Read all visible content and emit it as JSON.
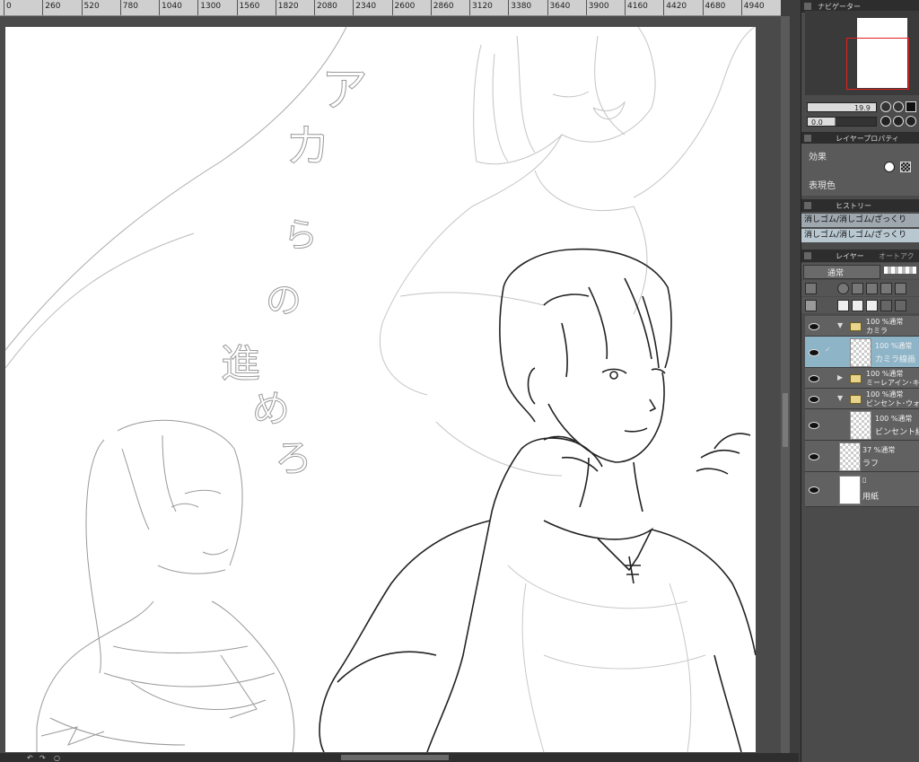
{
  "ruler": {
    "ticks": [
      "0",
      "260",
      "520",
      "780",
      "1040",
      "1300",
      "1560",
      "1820",
      "2080",
      "2340",
      "2600",
      "2860",
      "3120",
      "3380",
      "3640",
      "3900",
      "4160",
      "4420",
      "4680",
      "4940"
    ]
  },
  "canvas": {
    "vertical_text": [
      "ア",
      "カ",
      "ら",
      "の",
      "進",
      "め",
      "ろ"
    ]
  },
  "panel": {
    "navigator_tab": "ナビゲーター",
    "zoom_value": "19.9",
    "rotation_value": "0.0",
    "layer_property_tab": "レイヤープロパティ",
    "effect_label": "効果",
    "expression_color_label": "表現色",
    "history_tab": "ヒストリー",
    "history_items": [
      "消しゴム/消しゴム/ざっくり",
      "消しゴム/消しゴム/ざっくり"
    ],
    "layer_tab": "レイヤー",
    "auto_action_tab": "オートアクション",
    "blend_mode": "通常",
    "layers": [
      {
        "opacity": "100 %通常",
        "name": "カミラ",
        "type": "folder"
      },
      {
        "opacity": "100 %通常",
        "name": "カミラ線画",
        "type": "raster"
      },
      {
        "opacity": "100 %通常",
        "name": "ミーレアイン･キー",
        "type": "folder"
      },
      {
        "opacity": "100 %通常",
        "name": "ビンセント･ウォー",
        "type": "folder"
      },
      {
        "opacity": "100 %通常",
        "name": "ビンセント線画",
        "type": "raster"
      },
      {
        "opacity": "37 %通常",
        "name": "ラフ",
        "type": "raster"
      },
      {
        "opacity": "",
        "name": "用紙",
        "type": "paper"
      }
    ]
  },
  "colors": {
    "panel_bg": "#4b4b4b",
    "selected_layer": "#8eb4c7",
    "nav_frame": "#e02020",
    "paper": "#ffffff"
  }
}
